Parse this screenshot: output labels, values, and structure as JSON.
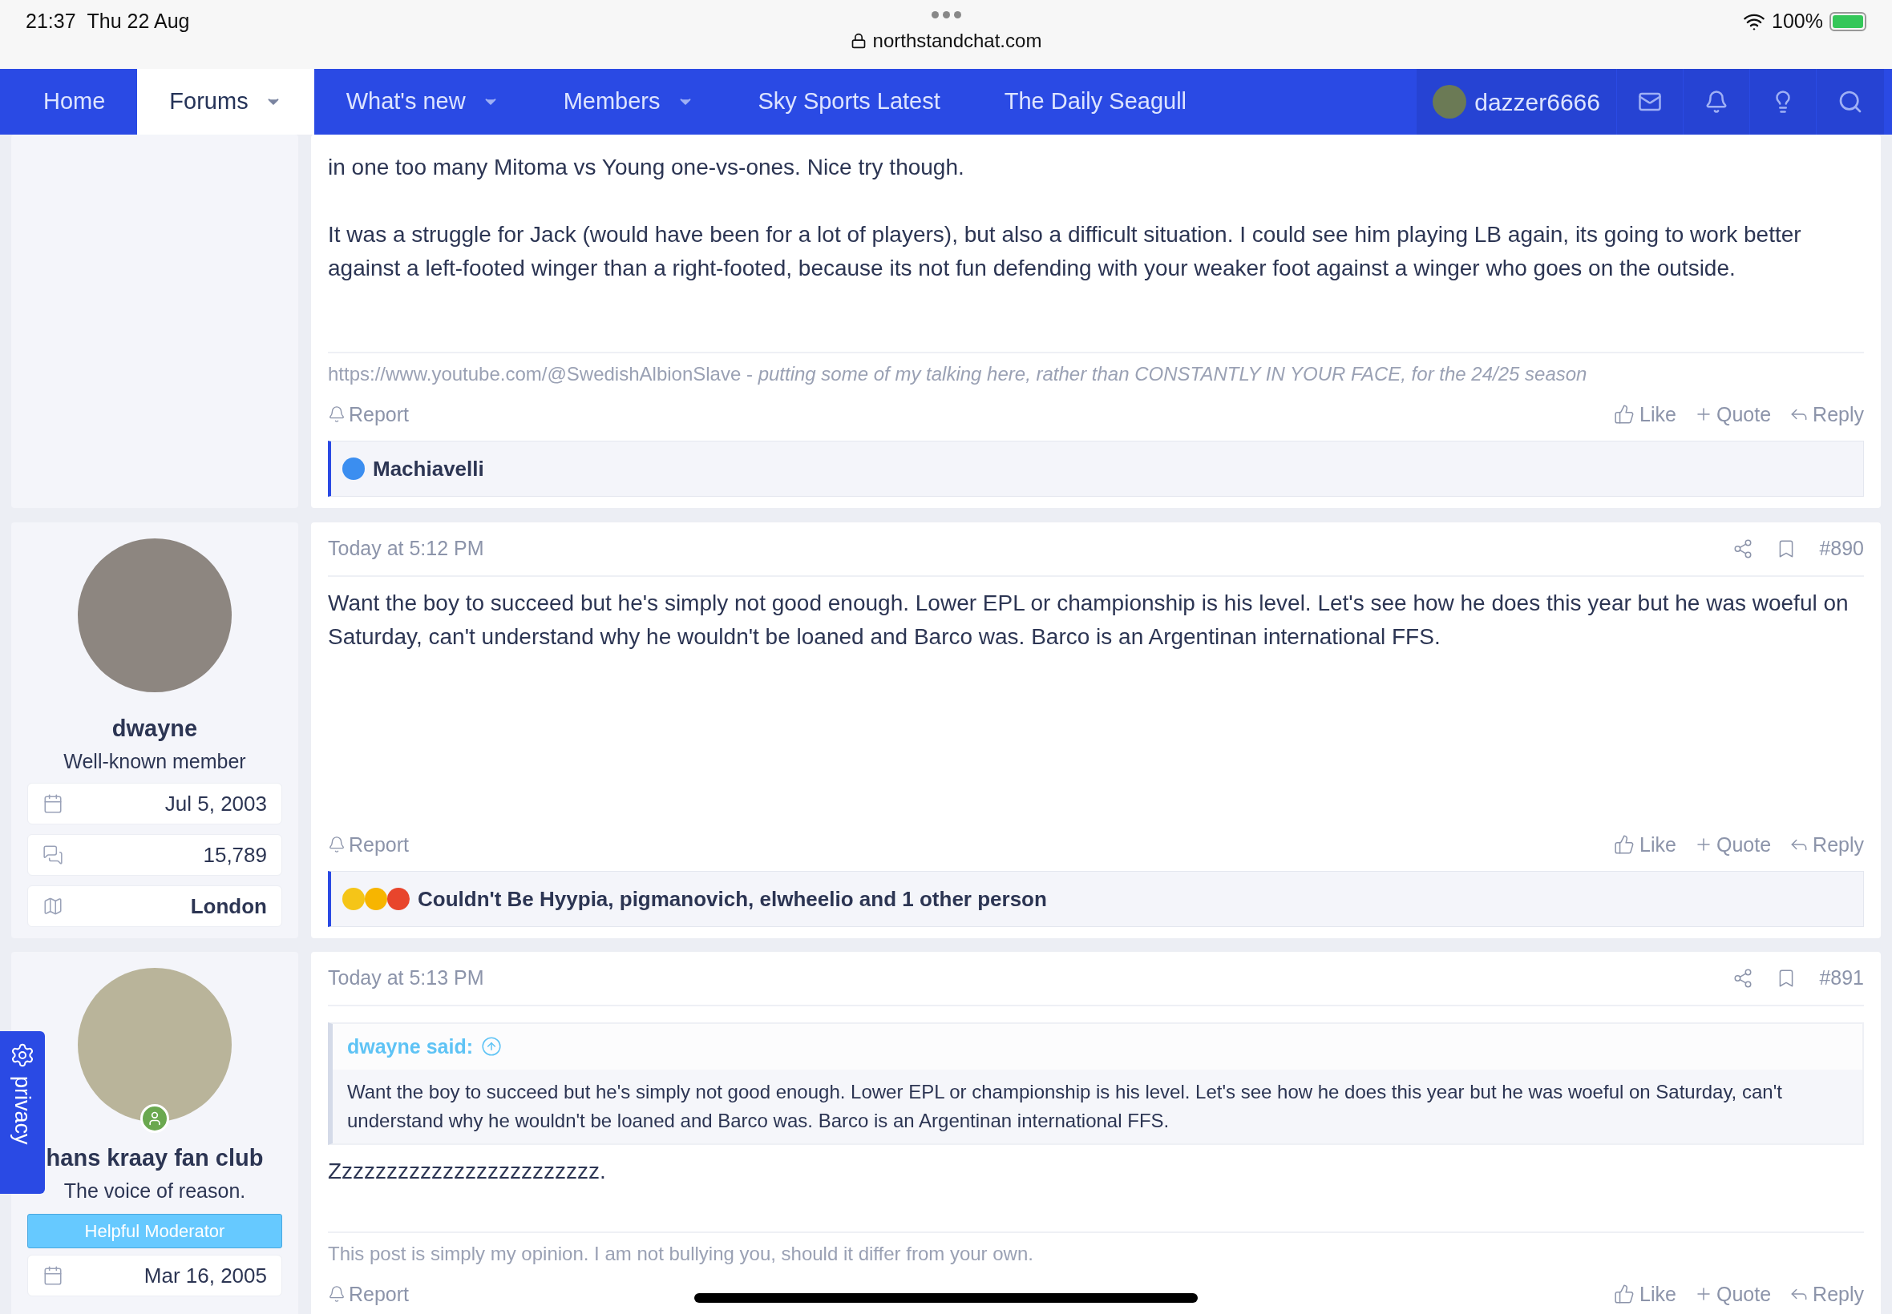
{
  "status_bar": {
    "time": "21:37",
    "date": "Thu 22 Aug",
    "url": "northstandchat.com",
    "battery": "100%",
    "charging": true
  },
  "nav": {
    "items": [
      {
        "label": "Home",
        "selected": false,
        "dropdown": false
      },
      {
        "label": "Forums",
        "selected": true,
        "dropdown": true
      },
      {
        "label": "What's new",
        "selected": false,
        "dropdown": true
      },
      {
        "label": "Members",
        "selected": false,
        "dropdown": true
      },
      {
        "label": "Sky Sports Latest",
        "selected": false,
        "dropdown": false
      },
      {
        "label": "The Daily Seagull",
        "selected": false,
        "dropdown": false
      }
    ],
    "username": "dazzer6666"
  },
  "privacy": {
    "label": "privacy"
  },
  "posts": [
    {
      "body": [
        "in one too many Mitoma vs Young one-vs-ones. Nice try though.",
        "It was a struggle for Jack (would have been for a lot of players), but also a difficult situation. I could see him playing LB again, its going to work better against a left-footed winger than a right-footed, because its not fun defending with your weaker foot against a winger who goes on the outside."
      ],
      "signature": "https://www.youtube.com/@SwedishAlbionSlave - *putting some of my talking here, rather than CONSTANTLY IN YOUR FACE, for the 24/25 season*",
      "actions": {
        "report": "Report",
        "like": "Like",
        "quote": "Quote",
        "reply": "Reply"
      },
      "reactions": {
        "emojis": [
          {
            "kind": "like"
          }
        ],
        "text": "Machiavelli"
      }
    },
    {
      "user": {
        "name": "dwayne",
        "title": "Well-known member",
        "online": false,
        "stats": [
          {
            "kind": "joined",
            "value": "Jul 5, 2003"
          },
          {
            "kind": "messages",
            "value": "15,789"
          },
          {
            "kind": "location",
            "value": "London"
          }
        ]
      },
      "time": "Today at 5:12 PM",
      "number": "#890",
      "body": [
        "Want the boy to succeed but he's simply not good enough. Lower EPL or championship is his level. Let's see how he does this year but he was woeful on Saturday, can't understand why he wouldn't be loaned and Barco was. Barco is an Argentinan international FFS."
      ],
      "actions": {
        "report": "Report",
        "like": "Like",
        "quote": "Quote",
        "reply": "Reply"
      },
      "reactions": {
        "emojis": [
          {
            "kind": "laugh"
          },
          {
            "kind": "shocked"
          },
          {
            "kind": "angry"
          }
        ],
        "text": "Couldn't Be Hyypia, pigmanovich, elwheelio and 1 other person"
      }
    },
    {
      "user": {
        "name": "hans kraay fan club",
        "title": "The voice of reason.",
        "banner": "Helpful Moderator",
        "online": true,
        "stats": [
          {
            "kind": "joined",
            "value": "Mar 16, 2005"
          }
        ]
      },
      "time": "Today at 5:13 PM",
      "number": "#891",
      "quote": {
        "author": "dwayne said:",
        "text": "Want the boy to succeed but he's simply not good enough. Lower EPL or championship is his level. Let's see how he does this year but he was woeful on Saturday, can't understand why he wouldn't be loaned and Barco was. Barco is an Argentinan international FFS."
      },
      "body": [
        "Zzzzzzzzzzzzzzzzzzzzzzzz."
      ],
      "signature": "This post is simply my opinion. I am not bullying you, should it differ from your own.",
      "actions": {
        "report": "Report",
        "like": "Like",
        "quote": "Quote",
        "reply": "Reply"
      }
    }
  ]
}
